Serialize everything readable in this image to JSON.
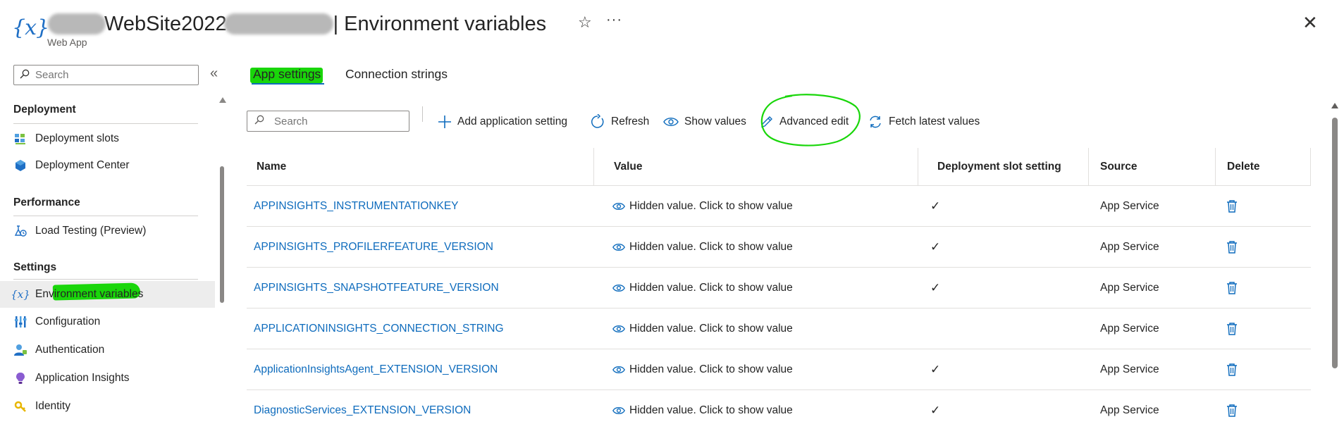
{
  "header": {
    "app_icon_text": "{x}",
    "title_visible": "WebSite2022",
    "title_suffix": "| Environment variables",
    "subtitle": "Web App"
  },
  "sidebar": {
    "search_placeholder": "Search",
    "sections": [
      {
        "label": "Deployment",
        "items": [
          {
            "label": "Deployment slots",
            "icon": "deployment-slots-icon"
          },
          {
            "label": "Deployment Center",
            "icon": "deployment-center-icon"
          }
        ]
      },
      {
        "label": "Performance",
        "items": [
          {
            "label": "Load Testing (Preview)",
            "icon": "load-testing-icon"
          }
        ]
      },
      {
        "label": "Settings",
        "items": [
          {
            "label": "Environment variables",
            "icon": "environment-variables-icon",
            "active": true
          },
          {
            "label": "Configuration",
            "icon": "configuration-icon"
          },
          {
            "label": "Authentication",
            "icon": "authentication-icon"
          },
          {
            "label": "Application Insights",
            "icon": "application-insights-icon"
          },
          {
            "label": "Identity",
            "icon": "identity-icon"
          }
        ]
      }
    ]
  },
  "tabs": [
    {
      "label": "App settings",
      "active": true
    },
    {
      "label": "Connection strings",
      "active": false
    }
  ],
  "toolbar": {
    "search_placeholder": "Search",
    "add": "Add application setting",
    "refresh": "Refresh",
    "show_values": "Show values",
    "advanced_edit": "Advanced edit",
    "fetch_latest": "Fetch latest values"
  },
  "table": {
    "columns": [
      "Name",
      "Value",
      "Deployment slot setting",
      "Source",
      "Delete"
    ],
    "rows": [
      {
        "name": "APPINSIGHTS_INSTRUMENTATIONKEY",
        "value": "Hidden value. Click to show value",
        "slot_setting": true,
        "source": "App Service"
      },
      {
        "name": "APPINSIGHTS_PROFILERFEATURE_VERSION",
        "value": "Hidden value. Click to show value",
        "slot_setting": true,
        "source": "App Service"
      },
      {
        "name": "APPINSIGHTS_SNAPSHOTFEATURE_VERSION",
        "value": "Hidden value. Click to show value",
        "slot_setting": true,
        "source": "App Service"
      },
      {
        "name": "APPLICATIONINSIGHTS_CONNECTION_STRING",
        "value": "Hidden value. Click to show value",
        "slot_setting": false,
        "source": "App Service"
      },
      {
        "name": "ApplicationInsightsAgent_EXTENSION_VERSION",
        "value": "Hidden value. Click to show value",
        "slot_setting": true,
        "source": "App Service"
      },
      {
        "name": "DiagnosticServices_EXTENSION_VERSION",
        "value": "Hidden value. Click to show value",
        "slot_setting": true,
        "source": "App Service"
      }
    ],
    "check_glyph": "✓"
  },
  "colors": {
    "accent": "#0f6cbd",
    "highlight": "#19d60a",
    "link": "#0f6cbd"
  }
}
